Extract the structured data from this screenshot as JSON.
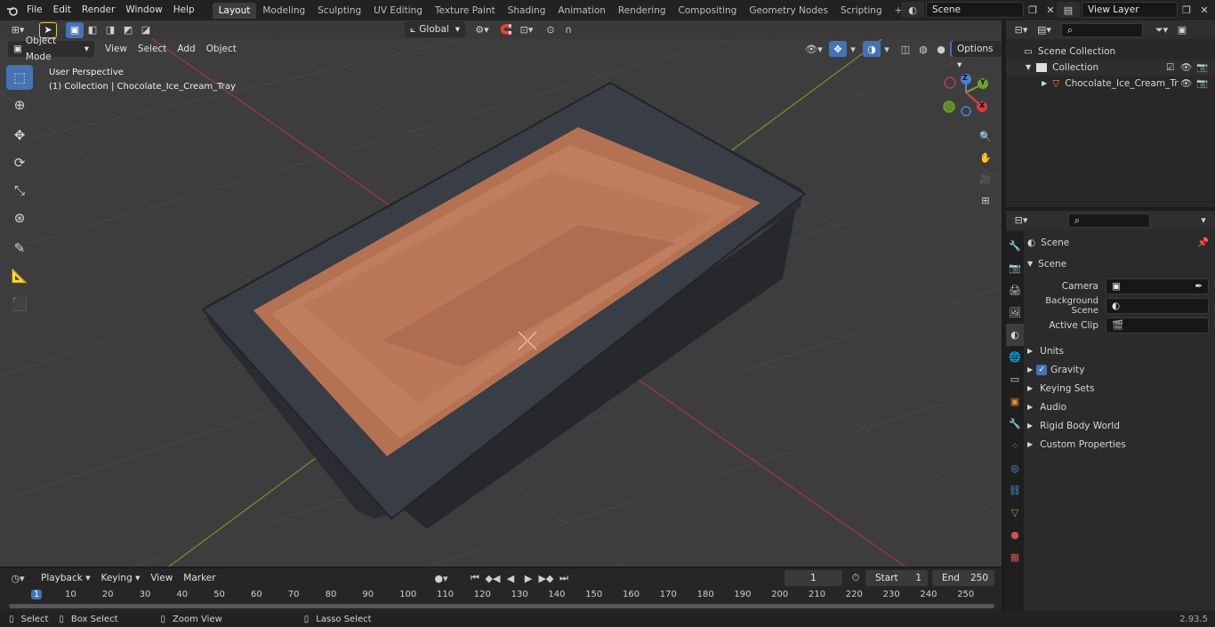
{
  "topbar": {
    "menus": [
      "File",
      "Edit",
      "Render",
      "Window",
      "Help"
    ],
    "workspaces": [
      "Layout",
      "Modeling",
      "Sculpting",
      "UV Editing",
      "Texture Paint",
      "Shading",
      "Animation",
      "Rendering",
      "Compositing",
      "Geometry Nodes",
      "Scripting"
    ],
    "active_workspace": "Layout",
    "scene": "Scene",
    "view_layer": "View Layer"
  },
  "viewport": {
    "mode": "Object Mode",
    "menus": [
      "View",
      "Select",
      "Add",
      "Object"
    ],
    "orientation": "Global",
    "options_label": "Options",
    "overlay_title": "User Perspective",
    "overlay_subtitle": "(1) Collection | Chocolate_Ice_Cream_Tray",
    "gizmo": {
      "z": "Z",
      "y": "Y",
      "x": "X"
    }
  },
  "outliner": {
    "root": "Scene Collection",
    "collection": "Collection",
    "object": "Chocolate_Ice_Cream_Tr"
  },
  "properties": {
    "header": "Scene",
    "panel": "Scene",
    "fields": [
      {
        "label": "Camera",
        "value": ""
      },
      {
        "label": "Background Scene",
        "value": ""
      },
      {
        "label": "Active Clip",
        "value": ""
      }
    ],
    "sections": [
      "Units",
      "Gravity",
      "Keying Sets",
      "Audio",
      "Rigid Body World",
      "Custom Properties"
    ]
  },
  "timeline": {
    "menus": [
      "Playback",
      "Keying",
      "View",
      "Marker"
    ],
    "current_frame": "1",
    "start_label": "Start",
    "start": "1",
    "end_label": "End",
    "end": "250",
    "ticks": [
      "1",
      "10",
      "20",
      "30",
      "40",
      "50",
      "60",
      "70",
      "80",
      "90",
      "100",
      "110",
      "120",
      "130",
      "140",
      "150",
      "160",
      "170",
      "180",
      "190",
      "200",
      "210",
      "220",
      "230",
      "240",
      "250"
    ]
  },
  "statusbar": {
    "items": [
      "Select",
      "Box Select",
      "Zoom View",
      "Lasso Select"
    ],
    "version": "2.93.5"
  }
}
